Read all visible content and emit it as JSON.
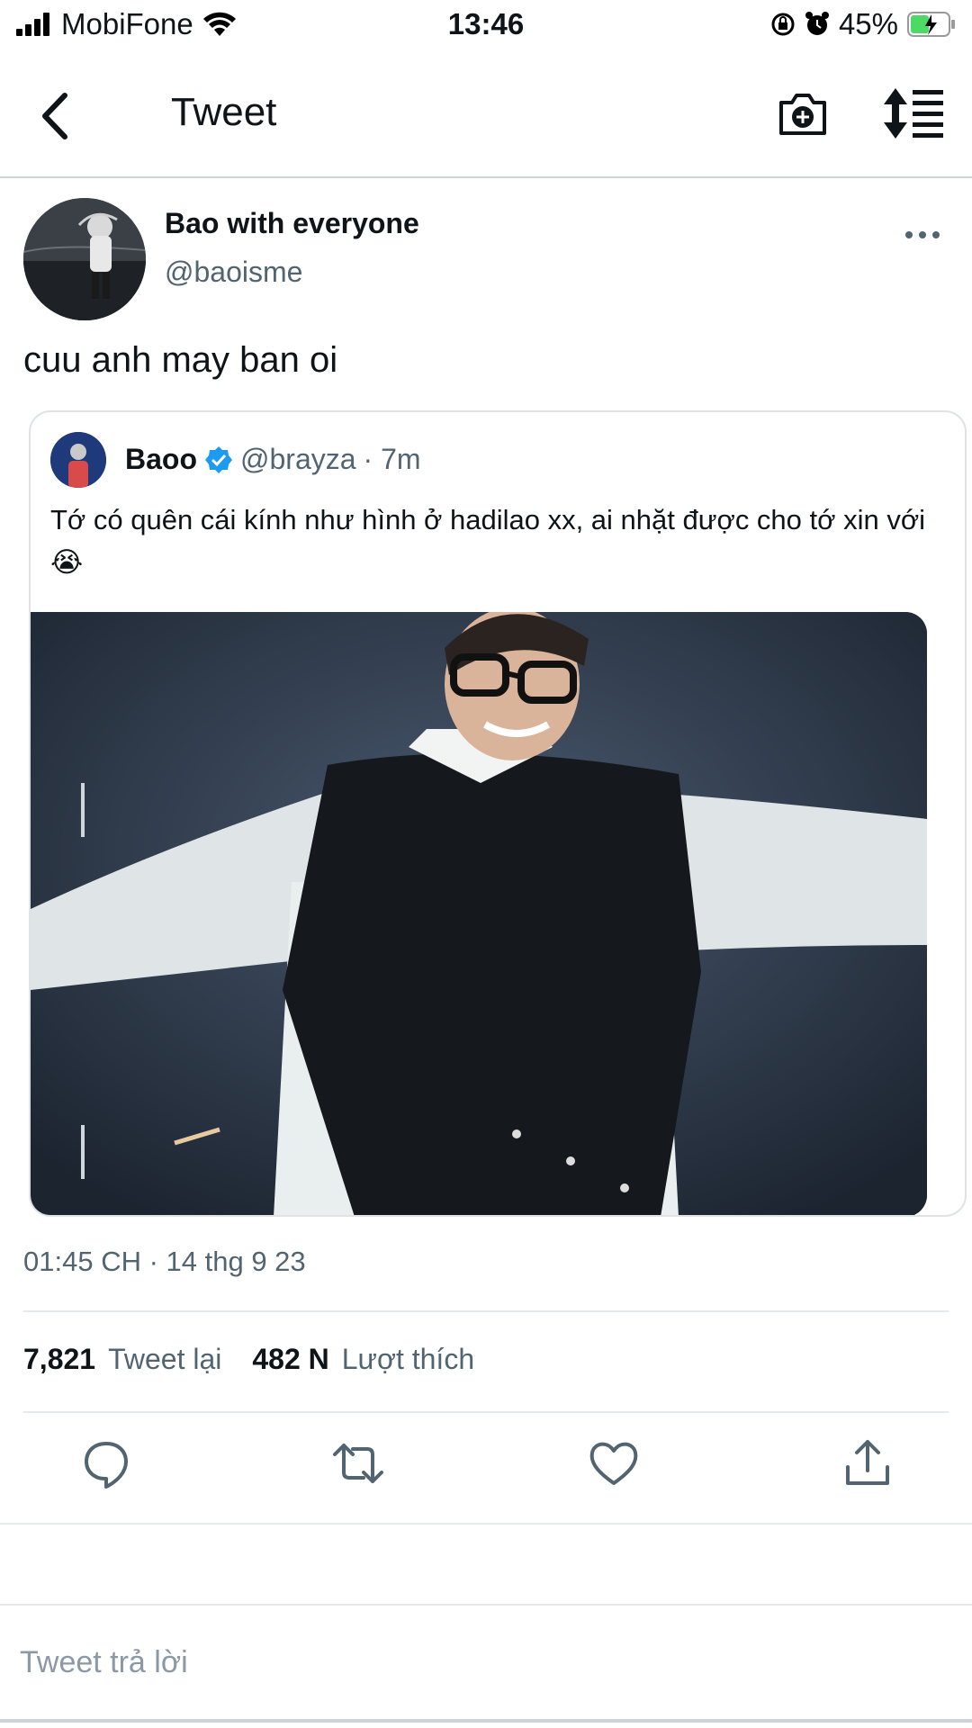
{
  "status_bar": {
    "carrier": "MobiFone",
    "time": "13:46",
    "battery": "45%"
  },
  "nav": {
    "title": "Tweet"
  },
  "tweet": {
    "author_name": "Bao with everyone",
    "author_handle": "@baoisme",
    "text": "cuu anh may ban oi",
    "timestamp": "01:45 CH · 14 thg 9 23"
  },
  "quote": {
    "name": "Baoo",
    "handle": "@brayza",
    "time": "· 7m",
    "text": "Tớ có quên cái kính như hình ở hadilao xx, ai nhặt được cho tớ xin với 😭"
  },
  "stats": {
    "retweets": "7,821",
    "retweets_label": "Tweet lại",
    "likes": "482 N",
    "likes_label": "Lượt thích"
  },
  "reply": {
    "placeholder": "Tweet trả lời"
  },
  "colors": {
    "text": "#0f1419",
    "secondary": "#536471",
    "verified": "#1d9bf0",
    "battery_charge": "#4cd964"
  },
  "icons": [
    "signal-icon",
    "wifi-icon",
    "orientation-lock-icon",
    "alarm-icon",
    "battery-icon",
    "back-arrow-icon",
    "camera-add-icon",
    "sort-icon",
    "more-icon",
    "verified-icon",
    "reply-icon",
    "retweet-icon",
    "like-icon",
    "share-icon"
  ]
}
